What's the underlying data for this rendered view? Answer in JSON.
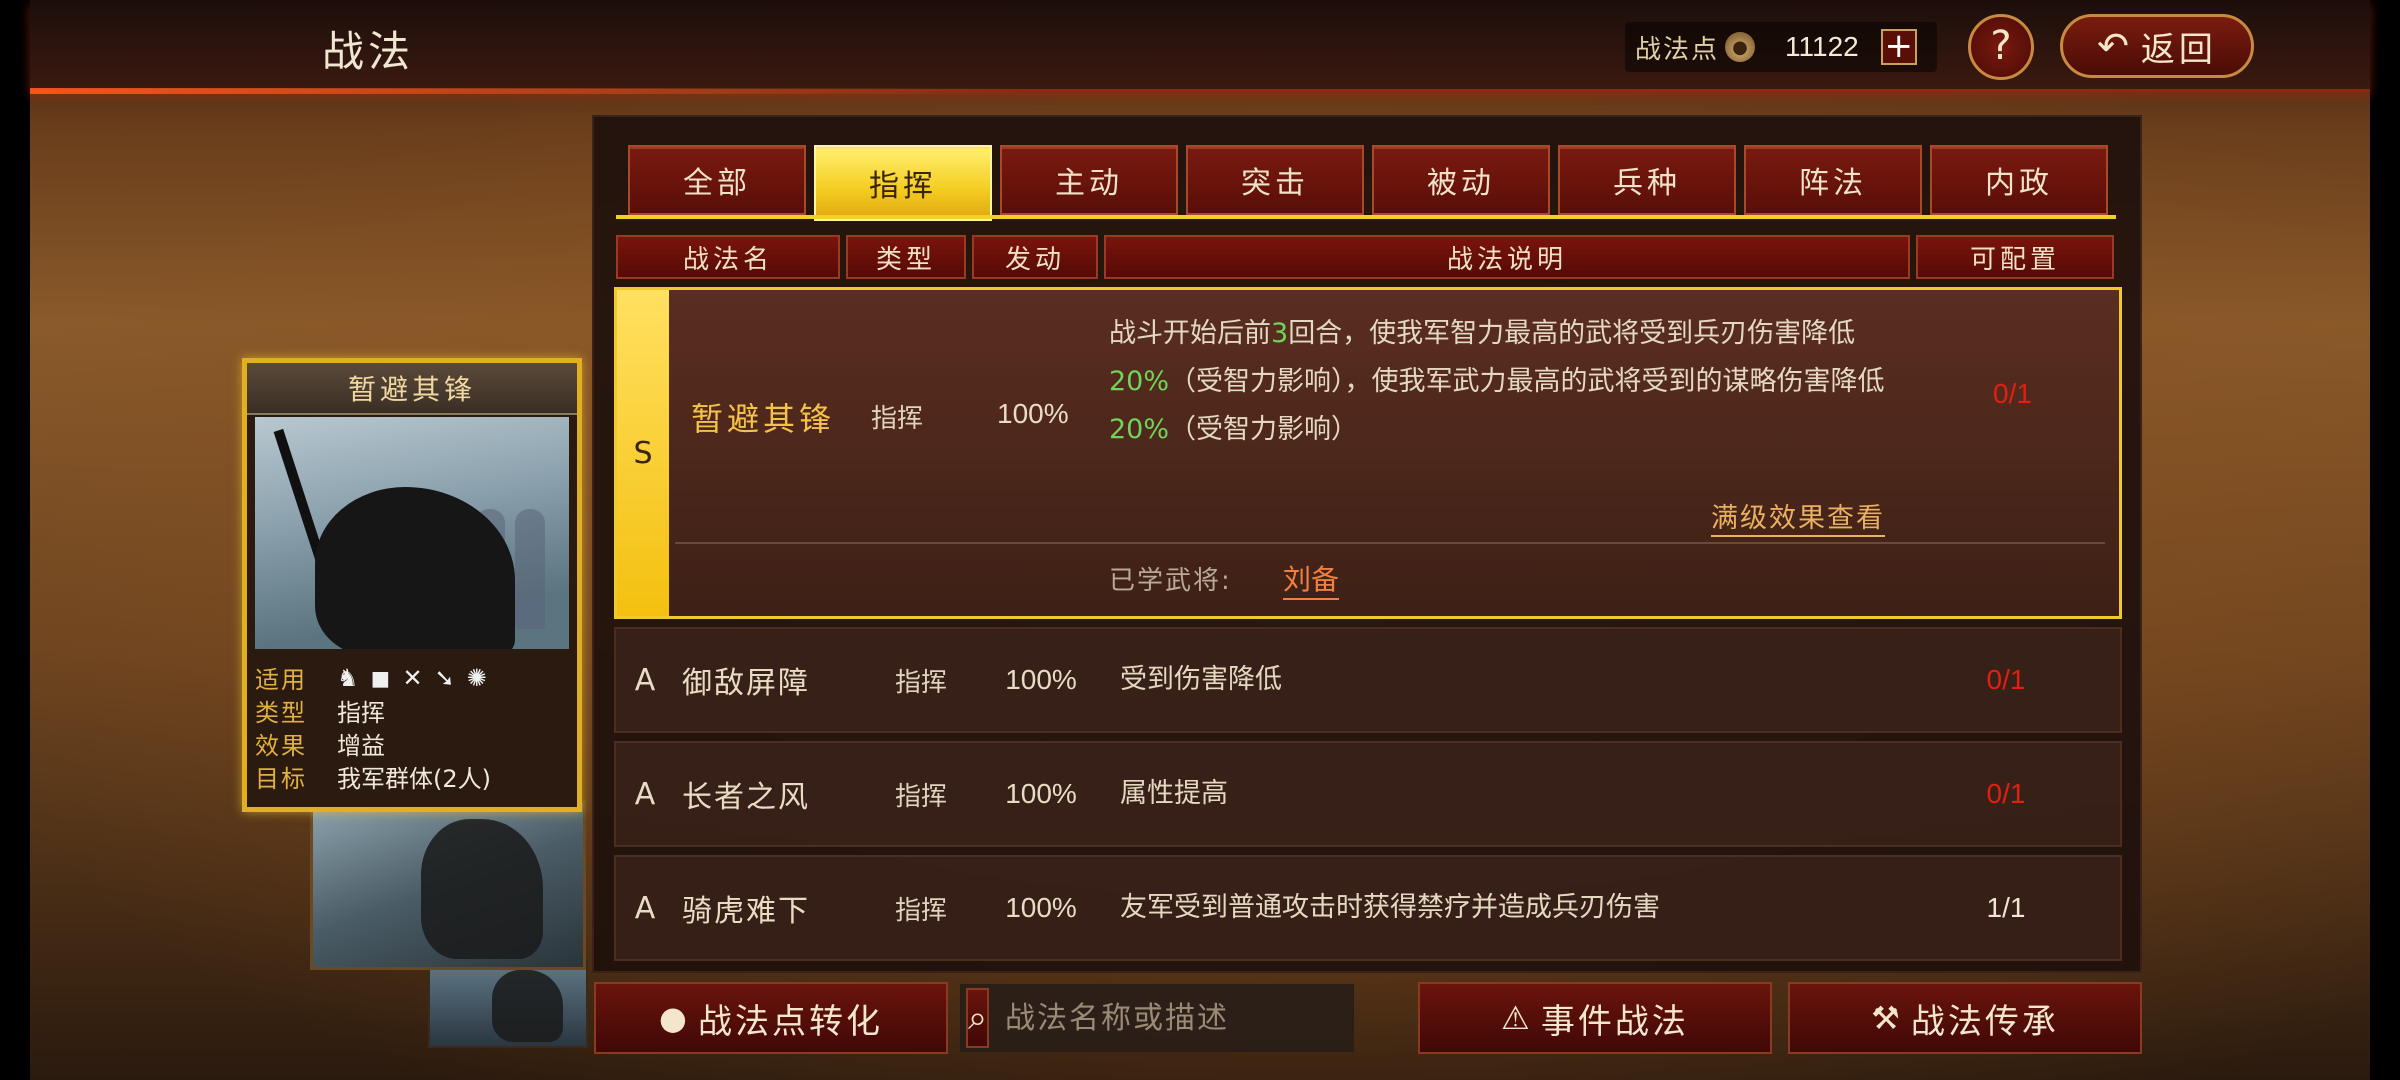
{
  "header": {
    "title": "战法",
    "points_label": "战法点",
    "points_value": "11122",
    "plus": "+",
    "help": "?",
    "back_label": "返回"
  },
  "tabs": [
    "全部",
    "指挥",
    "主动",
    "突击",
    "被动",
    "兵种",
    "阵法",
    "内政"
  ],
  "active_tab": "指挥",
  "columns": [
    "战法名",
    "类型",
    "发动",
    "战法说明",
    "可配置"
  ],
  "selected": {
    "grade": "S",
    "name": "暂避其锋",
    "type": "指挥",
    "rate": "100%",
    "desc_1": "战斗开始后前",
    "desc_2": "3",
    "desc_3": "回合，使我军智力最高的武将受到兵刃伤害降低",
    "desc_4": "20%",
    "desc_5": "（受智力影响），使我军武力最高的武将受到的谋略伤害降低",
    "desc_6": "20%",
    "desc_7": "（受智力影响）",
    "quota": "0/1",
    "max_link": "满级效果查看",
    "learned_label": "已学武将:",
    "learned_name": "刘备"
  },
  "rows": [
    {
      "grade": "A",
      "name": "御敌屏障",
      "type": "指挥",
      "rate": "100%",
      "desc": "受到伤害降低",
      "quota": "0/1"
    },
    {
      "grade": "A",
      "name": "长者之风",
      "type": "指挥",
      "rate": "100%",
      "desc": "属性提高",
      "quota": "0/1"
    },
    {
      "grade": "A",
      "name": "骑虎难下",
      "type": "指挥",
      "rate": "100%",
      "desc": "友军受到普通攻击时获得禁疗并造成兵刃伤害",
      "quota": "1/1"
    }
  ],
  "card": {
    "title": "暂避其锋",
    "applies_label": "适用",
    "type_label": "类型",
    "type_value": "指挥",
    "effect_label": "效果",
    "effect_value": "增益",
    "target_label": "目标",
    "target_value": "我军群体(2人)",
    "unit_icons": [
      "cavalry-icon",
      "shield-icon",
      "bow-icon",
      "spear-icon",
      "chariot-icon"
    ]
  },
  "bottom": {
    "convert_label": "战法点转化",
    "search_placeholder": "战法名称或描述",
    "event_label": "事件战法",
    "inherit_label": "战法传承"
  },
  "colors": {
    "accent_gold": "#f4cc20",
    "quota_red": "#e02010",
    "highlight_green": "#6ed45a",
    "learned_orange": "#f08040"
  }
}
